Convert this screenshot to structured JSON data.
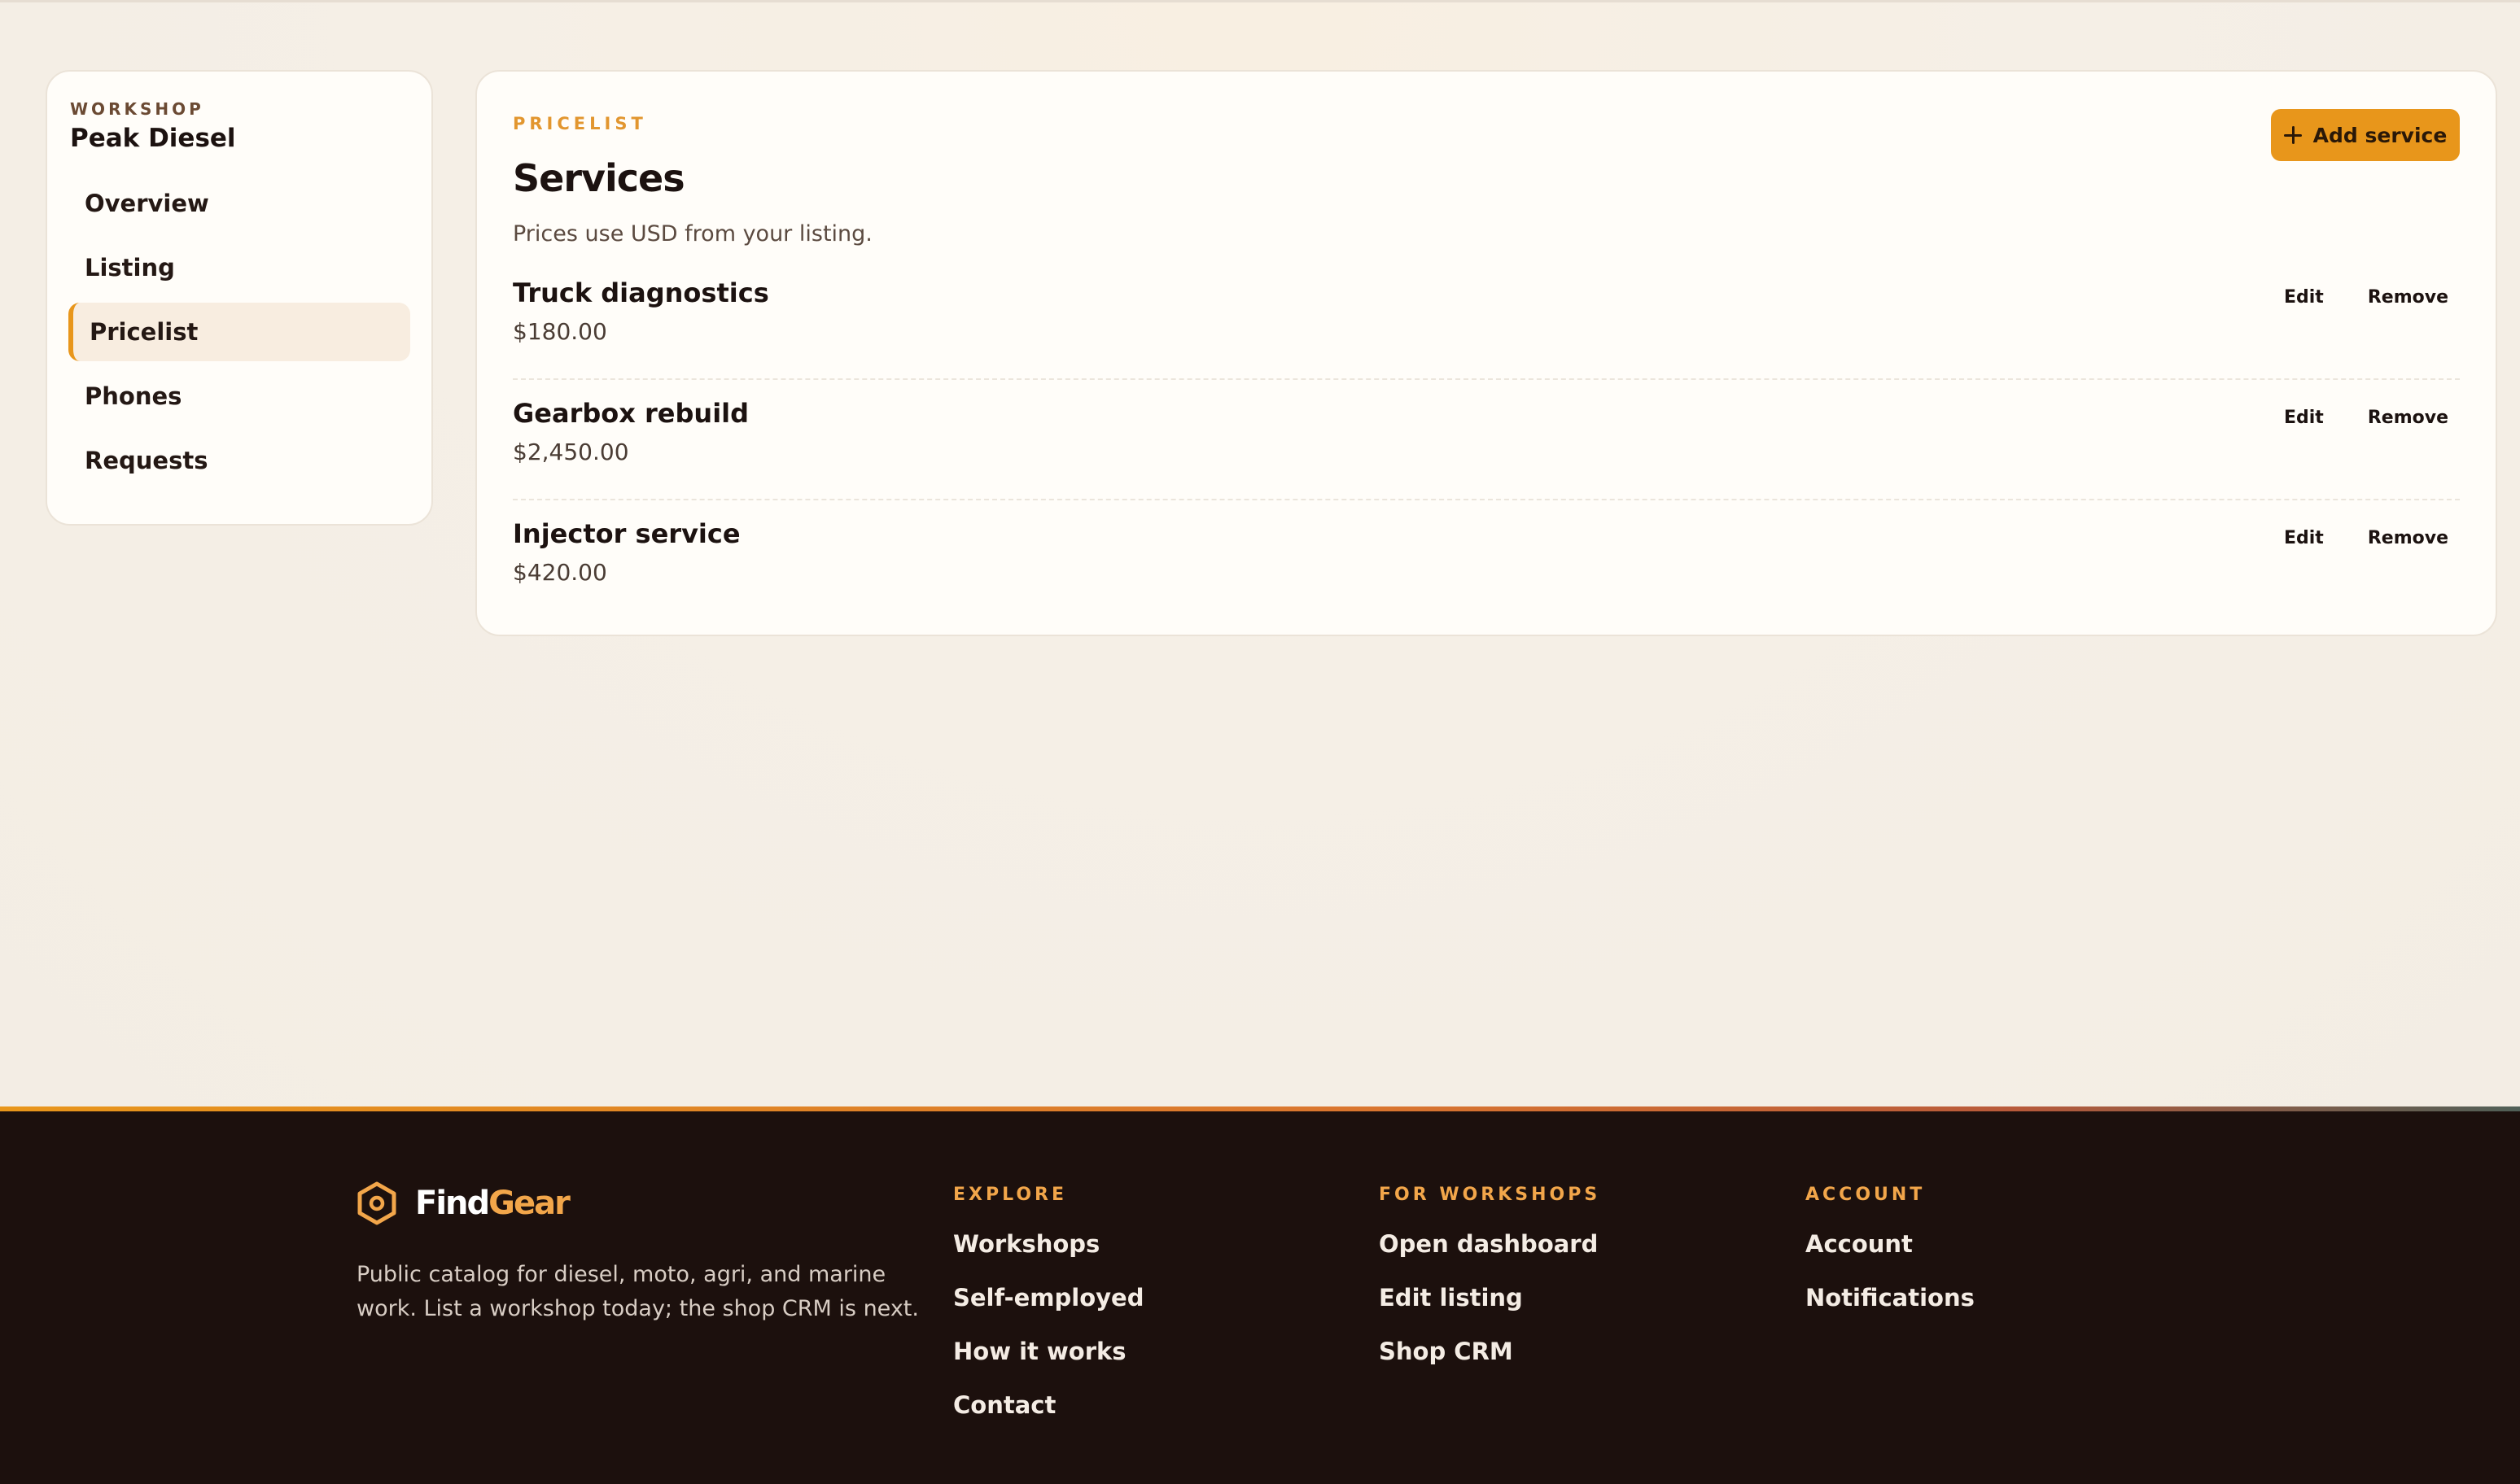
{
  "sidebar": {
    "eyebrow": "WORKSHOP",
    "workshop_name": "Peak Diesel",
    "items": [
      {
        "label": "Overview",
        "active": false
      },
      {
        "label": "Listing",
        "active": false
      },
      {
        "label": "Pricelist",
        "active": true
      },
      {
        "label": "Phones",
        "active": false
      },
      {
        "label": "Requests",
        "active": false
      }
    ]
  },
  "main": {
    "eyebrow": "PRICELIST",
    "title": "Services",
    "subtitle": "Prices use USD from your listing.",
    "add_button_label": "Add service",
    "edit_label": "Edit",
    "remove_label": "Remove",
    "services": [
      {
        "name": "Truck diagnostics",
        "price": "$180.00"
      },
      {
        "name": "Gearbox rebuild",
        "price": "$2,450.00"
      },
      {
        "name": "Injector service",
        "price": "$420.00"
      }
    ]
  },
  "footer": {
    "brand_first": "Find",
    "brand_second": "Gear",
    "tagline": "Public catalog for diesel, moto, agri, and marine work. List a workshop today; the shop CRM is next.",
    "columns": [
      {
        "heading": "EXPLORE",
        "links": [
          "Workshops",
          "Self-employed",
          "How it works",
          "Contact"
        ]
      },
      {
        "heading": "FOR WORKSHOPS",
        "links": [
          "Open dashboard",
          "Edit listing",
          "Shop CRM"
        ]
      },
      {
        "heading": "ACCOUNT",
        "links": [
          "Account",
          "Notifications"
        ]
      }
    ]
  },
  "colors": {
    "accent": "#e8961b",
    "background": "#f5efe6",
    "footer_bg": "#1c100d",
    "card_bg": "#fffdf9"
  }
}
